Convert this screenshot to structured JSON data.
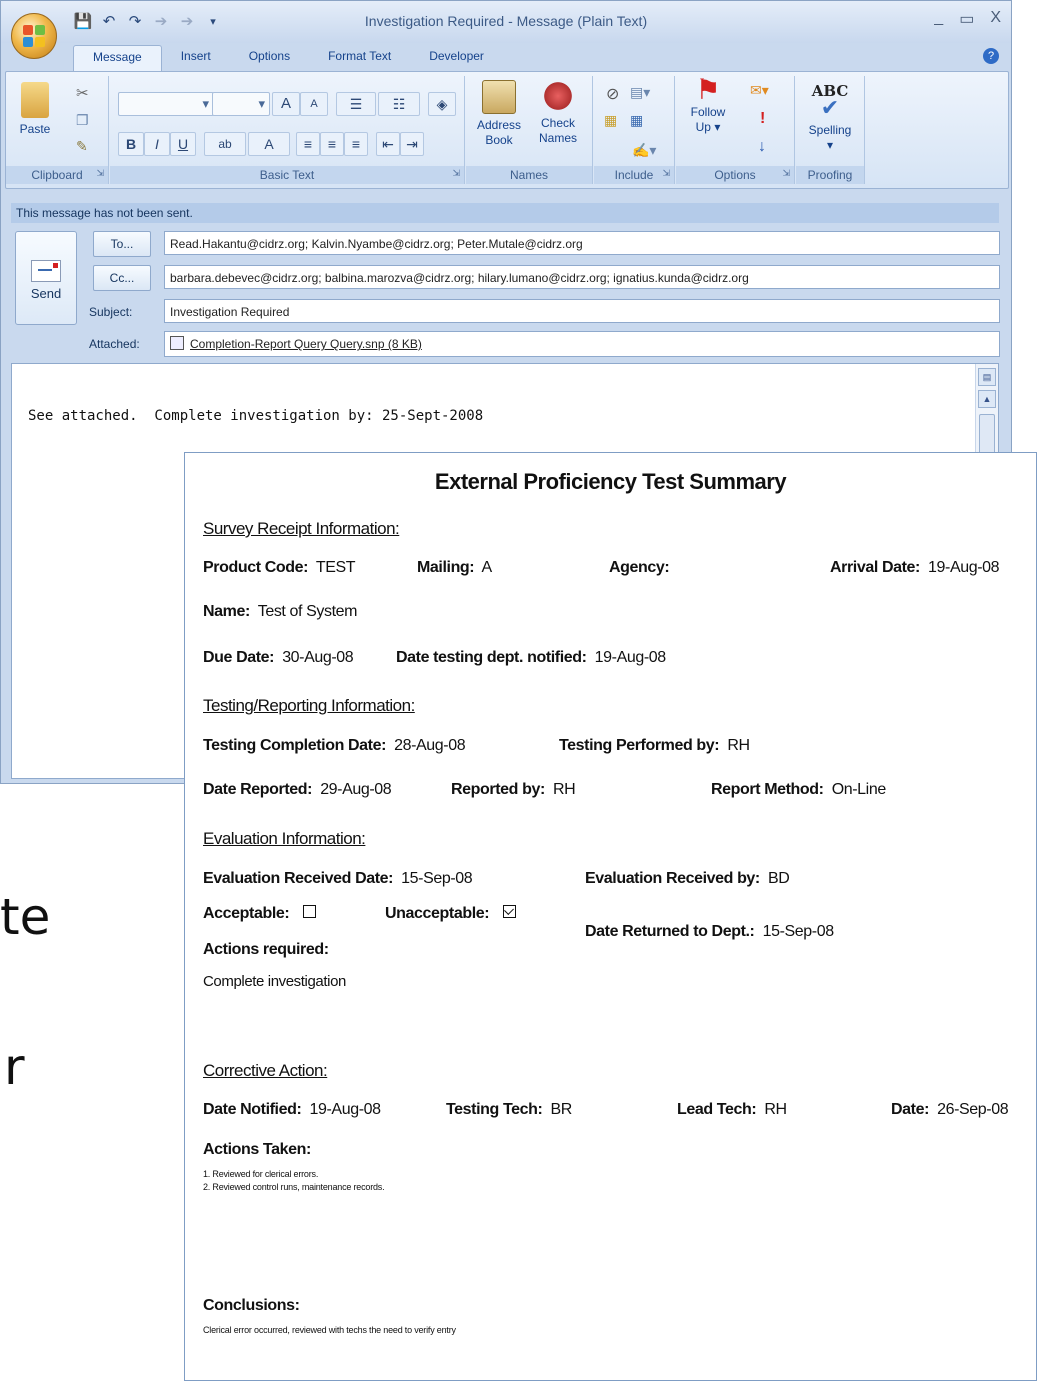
{
  "background_text": {
    "line1": "te",
    "line2": "r"
  },
  "window": {
    "title": "Investigation Required - Message (Plain Text)",
    "quick_access": [
      "save-icon",
      "undo-icon",
      "redo-icon",
      "up-icon",
      "down-icon",
      "customize-icon"
    ],
    "controls": {
      "minimize": "_",
      "restore": "▭",
      "close": "X"
    }
  },
  "tabs": [
    "Message",
    "Insert",
    "Options",
    "Format Text",
    "Developer"
  ],
  "ribbon": {
    "clipboard": {
      "label": "Clipboard",
      "paste": "Paste"
    },
    "basic_text": {
      "label": "Basic Text",
      "bold": "B",
      "italic": "I",
      "underline": "U",
      "grow": "A",
      "shrink": "A",
      "color": "A",
      "abc": "ab"
    },
    "names": {
      "label": "Names",
      "address_book_line1": "Address",
      "address_book_line2": "Book",
      "check_names_line1": "Check",
      "check_names_line2": "Names"
    },
    "include": {
      "label": "Include"
    },
    "options": {
      "label": "Options",
      "follow_up_line1": "Follow",
      "follow_up_line2": "Up"
    },
    "proofing": {
      "label": "Proofing",
      "spelling": "Spelling",
      "abc": "ABC"
    }
  },
  "info_bar": "This message has not been sent.",
  "send_label": "Send",
  "address": {
    "to_label": "To...",
    "to_value": "Read.Hakantu@cidrz.org; Kalvin.Nyambe@cidrz.org; Peter.Mutale@cidrz.org",
    "cc_label": "Cc...",
    "cc_value": "barbara.debevec@cidrz.org; balbina.marozva@cidrz.org; hilary.lumano@cidrz.org; ignatius.kunda@cidrz.org",
    "subject_label": "Subject:",
    "subject_value": "Investigation Required",
    "attached_label": "Attached:",
    "attachment": "Completion-Report Query Query.snp (8 KB)"
  },
  "body_text": "See attached.  Complete investigation by: 25-Sept-2008",
  "report": {
    "title": "External Proficiency Test Summary",
    "survey_heading": "Survey Receipt Information:",
    "product_code_label": "Product Code:",
    "product_code": "TEST",
    "mailing_label": "Mailing:",
    "mailing": "A",
    "agency_label": "Agency:",
    "arrival_label": "Arrival Date:",
    "arrival": "19-Aug-08",
    "name_label": "Name:",
    "name": "Test of System",
    "due_label": "Due Date:",
    "due": "30-Aug-08",
    "notified_label": "Date testing dept. notified:",
    "notified": "19-Aug-08",
    "testing_heading": "Testing/Reporting Information:",
    "completion_label": "Testing Completion Date:",
    "completion": "28-Aug-08",
    "performed_label": "Testing Performed by:",
    "performed": "RH",
    "reported_date_label": "Date Reported:",
    "reported_date": "29-Aug-08",
    "reported_by_label": "Reported by:",
    "reported_by": "RH",
    "method_label": "Report Method:",
    "method": "On-Line",
    "evaluation_heading": "Evaluation Information:",
    "eval_received_label": "Evaluation Received Date:",
    "eval_received": "15-Sep-08",
    "eval_by_label": "Evaluation Received by:",
    "eval_by": "BD",
    "acceptable_label": "Acceptable:",
    "unacceptable_label": "Unacceptable:",
    "returned_label": "Date Returned to Dept.:",
    "returned": "15-Sep-08",
    "actions_required_label": "Actions required:",
    "actions_required": "Complete investigation",
    "corrective_heading": "Corrective Action:",
    "date_notified_label": "Date Notified:",
    "date_notified": "19-Aug-08",
    "tech_label": "Testing Tech:",
    "tech": "BR",
    "lead_label": "Lead Tech:",
    "lead": "RH",
    "date_label": "Date:",
    "date": "26-Sep-08",
    "actions_taken_label": "Actions Taken:",
    "action1": "1. Reviewed for clerical errors.",
    "action2": "2. Reviewed control runs, maintenance records.",
    "conclusions_label": "Conclusions:",
    "conclusions": "Clerical error occurred, reviewed with techs the need to verify entry"
  }
}
